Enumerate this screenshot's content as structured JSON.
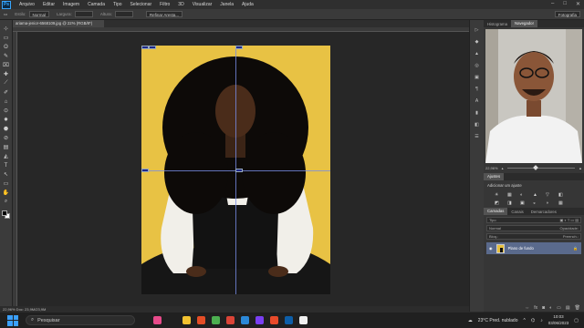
{
  "app": {
    "logo": "Ps"
  },
  "menu": [
    "Arquivo",
    "Editar",
    "Imagem",
    "Camada",
    "Tipo",
    "Selecionar",
    "Filtro",
    "3D",
    "Visualizar",
    "Janela",
    "Ajuda"
  ],
  "window_controls": [
    "–",
    "□",
    "✕"
  ],
  "options": {
    "estilo_label": "Estilo:",
    "estilo_value": "Normal",
    "largura_label": "Largura:",
    "altura_label": "Altura:",
    "refine_button": "Refinar Aresta...",
    "workspace": "Fotografia"
  },
  "document": {
    "tab_title": "ariama-jenior-6568109.jpg @ 22% (RGB/8*)",
    "status": "22,96%    Doc: 23,9M/23,9M"
  },
  "tools": [
    "⊹",
    "▭",
    "ʘ",
    "✎",
    "⌧",
    "✚",
    "⟋",
    "✐",
    "⌂",
    "⊙",
    "✸",
    "⬣",
    "⊘",
    "▤",
    "◭",
    "T",
    "↖",
    "▭",
    "✋",
    "⌕"
  ],
  "right_panels": {
    "tabs": [
      "Histograma",
      "Navegador"
    ],
    "active_tab": "Navegador",
    "zoom_value": "22,96%",
    "adjustments_tabs": [
      "Ajustes"
    ],
    "adjustments_title": "Adicionar um ajuste",
    "adjust_icons": [
      "☀",
      "▦",
      "◐",
      "▲",
      "▽",
      "◧",
      "◩",
      "◨",
      "▣",
      "◒",
      "◑",
      "▦",
      "◫",
      "◪",
      "◭",
      "◮",
      "▩",
      "◰"
    ],
    "layers_tabs": [
      "Camadas",
      "Canais",
      "Demarcadores"
    ],
    "active_layers_tab": "Camadas",
    "kind_label": "Tipo",
    "blend_mode": "Normal",
    "opacity_label": "Opacidade:",
    "lock_label": "Bloq.:",
    "fill_label": "Preench.:",
    "layer_name": "Plano de fundo",
    "footer_icons": [
      "⇔",
      "fx",
      "◙",
      "◐",
      "▭",
      "▤",
      "🗑"
    ]
  },
  "strip_icons": [
    "▷",
    "◆",
    "▲",
    "◎",
    "▣",
    "¶",
    "A",
    "▮",
    "◧",
    "☰"
  ],
  "taskbar": {
    "search_placeholder": "Pesquisar",
    "weather": "23°C  Pred. nublado",
    "time": "10:03",
    "date": "03/06/2023",
    "app_colors": [
      "#e84a8a",
      "#202020",
      "#f2c230",
      "#e44d26",
      "#4caf50",
      "#db4437",
      "#2b88d8",
      "#7a3ff2",
      "#e84a2a",
      "#0d5ea8",
      "#f0f0f0"
    ]
  }
}
